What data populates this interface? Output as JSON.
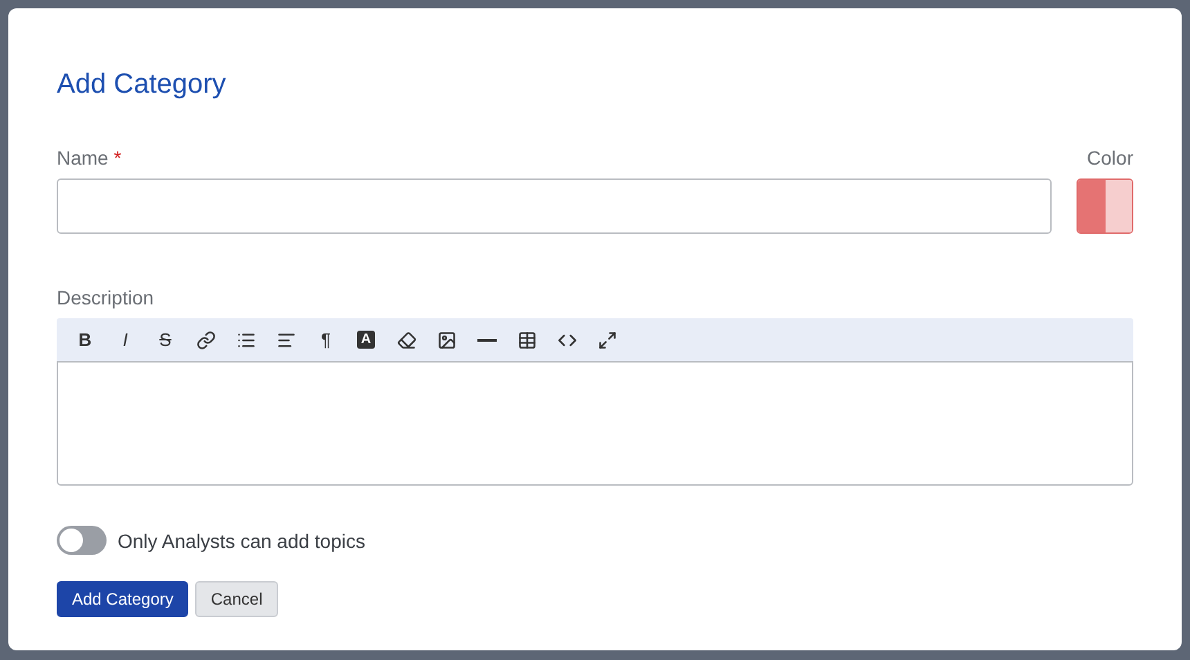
{
  "dialog": {
    "title": "Add Category"
  },
  "name_field": {
    "label": "Name",
    "required_mark": "*"
  },
  "color_picker": {
    "label": "Color",
    "color": "#e57373"
  },
  "description": {
    "label": "Description",
    "toolbar": [
      {
        "kind": "text",
        "label": "B"
      },
      {
        "kind": "text",
        "label": "I"
      },
      {
        "kind": "text",
        "label": "S"
      },
      {
        "kind": "icon"
      },
      {
        "kind": "icon"
      },
      {
        "kind": "icon"
      },
      {
        "kind": "text",
        "label": "¶"
      },
      {
        "kind": "text",
        "label": "A"
      },
      {
        "kind": "icon"
      },
      {
        "kind": "icon"
      },
      {
        "kind": "icon"
      },
      {
        "kind": "icon"
      },
      {
        "kind": "icon"
      },
      {
        "kind": "icon"
      }
    ]
  },
  "toggle": {
    "label": "Only Analysts can add topics",
    "on": false
  },
  "buttons": [
    {
      "label": "Add Category",
      "kind": "primary"
    },
    {
      "label": "Cancel",
      "kind": "secondary"
    }
  ]
}
